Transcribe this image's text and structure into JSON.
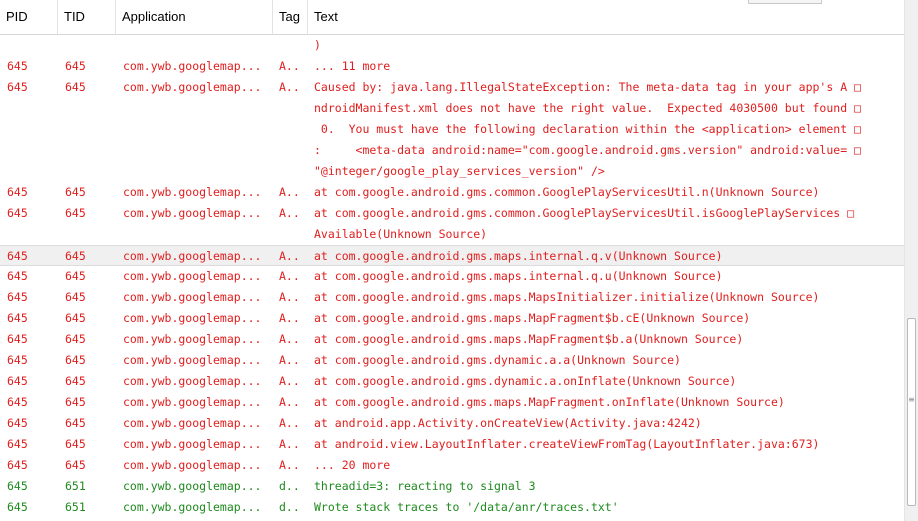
{
  "columns": {
    "pid": "PID",
    "tid": "TID",
    "application": "Application",
    "tag": "Tag",
    "text": "Text"
  },
  "rows": [
    {
      "pid": "",
      "tid": "",
      "application": "",
      "tag": "",
      "level": "error",
      "text_lines": [
        ")"
      ]
    },
    {
      "pid": "645",
      "tid": "645",
      "application": "com.ywb.googlemap...",
      "tag": "A..",
      "level": "error",
      "text_lines": [
        "... 11 more"
      ]
    },
    {
      "pid": "645",
      "tid": "645",
      "application": "com.ywb.googlemap...",
      "tag": "A..",
      "level": "error",
      "text_lines": [
        "Caused by: java.lang.IllegalStateException: The meta-data tag in your app's A □",
        "ndroidManifest.xml does not have the right value.  Expected 4030500 but found □",
        " 0.  You must have the following declaration within the <application> element □",
        ":     <meta-data android:name=\"com.google.android.gms.version\" android:value= □",
        "\"@integer/google_play_services_version\" />"
      ]
    },
    {
      "pid": "645",
      "tid": "645",
      "application": "com.ywb.googlemap...",
      "tag": "A..",
      "level": "error",
      "text_lines": [
        "at com.google.android.gms.common.GooglePlayServicesUtil.n(Unknown Source)"
      ]
    },
    {
      "pid": "645",
      "tid": "645",
      "application": "com.ywb.googlemap...",
      "tag": "A..",
      "level": "error",
      "text_lines": [
        "at com.google.android.gms.common.GooglePlayServicesUtil.isGooglePlayServices □",
        "Available(Unknown Source)"
      ]
    },
    {
      "pid": "645",
      "tid": "645",
      "application": "com.ywb.googlemap...",
      "tag": "A..",
      "level": "error",
      "selected": true,
      "text_lines": [
        "at com.google.android.gms.maps.internal.q.v(Unknown Source)"
      ]
    },
    {
      "pid": "645",
      "tid": "645",
      "application": "com.ywb.googlemap...",
      "tag": "A..",
      "level": "error",
      "text_lines": [
        "at com.google.android.gms.maps.internal.q.u(Unknown Source)"
      ]
    },
    {
      "pid": "645",
      "tid": "645",
      "application": "com.ywb.googlemap...",
      "tag": "A..",
      "level": "error",
      "text_lines": [
        "at com.google.android.gms.maps.MapsInitializer.initialize(Unknown Source)"
      ]
    },
    {
      "pid": "645",
      "tid": "645",
      "application": "com.ywb.googlemap...",
      "tag": "A..",
      "level": "error",
      "text_lines": [
        "at com.google.android.gms.maps.MapFragment$b.cE(Unknown Source)"
      ]
    },
    {
      "pid": "645",
      "tid": "645",
      "application": "com.ywb.googlemap...",
      "tag": "A..",
      "level": "error",
      "text_lines": [
        "at com.google.android.gms.maps.MapFragment$b.a(Unknown Source)"
      ]
    },
    {
      "pid": "645",
      "tid": "645",
      "application": "com.ywb.googlemap...",
      "tag": "A..",
      "level": "error",
      "text_lines": [
        "at com.google.android.gms.dynamic.a.a(Unknown Source)"
      ]
    },
    {
      "pid": "645",
      "tid": "645",
      "application": "com.ywb.googlemap...",
      "tag": "A..",
      "level": "error",
      "text_lines": [
        "at com.google.android.gms.dynamic.a.onInflate(Unknown Source)"
      ]
    },
    {
      "pid": "645",
      "tid": "645",
      "application": "com.ywb.googlemap...",
      "tag": "A..",
      "level": "error",
      "text_lines": [
        "at com.google.android.gms.maps.MapFragment.onInflate(Unknown Source)"
      ]
    },
    {
      "pid": "645",
      "tid": "645",
      "application": "com.ywb.googlemap...",
      "tag": "A..",
      "level": "error",
      "text_lines": [
        "at android.app.Activity.onCreateView(Activity.java:4242)"
      ]
    },
    {
      "pid": "645",
      "tid": "645",
      "application": "com.ywb.googlemap...",
      "tag": "A..",
      "level": "error",
      "text_lines": [
        "at android.view.LayoutInflater.createViewFromTag(LayoutInflater.java:673)"
      ]
    },
    {
      "pid": "645",
      "tid": "645",
      "application": "com.ywb.googlemap...",
      "tag": "A..",
      "level": "error",
      "text_lines": [
        "... 20 more"
      ]
    },
    {
      "pid": "645",
      "tid": "651",
      "application": "com.ywb.googlemap...",
      "tag": "d..",
      "level": "debug",
      "text_lines": [
        "threadid=3: reacting to signal 3"
      ]
    },
    {
      "pid": "645",
      "tid": "651",
      "application": "com.ywb.googlemap...",
      "tag": "d..",
      "level": "debug",
      "text_lines": [
        "Wrote stack traces to '/data/anr/traces.txt'"
      ]
    }
  ],
  "colors": {
    "error": "#e01e1e",
    "debug": "#1e8a1e",
    "selected_row": "#f0f0f0"
  },
  "scrollbar": {
    "grip_icon": "grip-lines-icon"
  }
}
